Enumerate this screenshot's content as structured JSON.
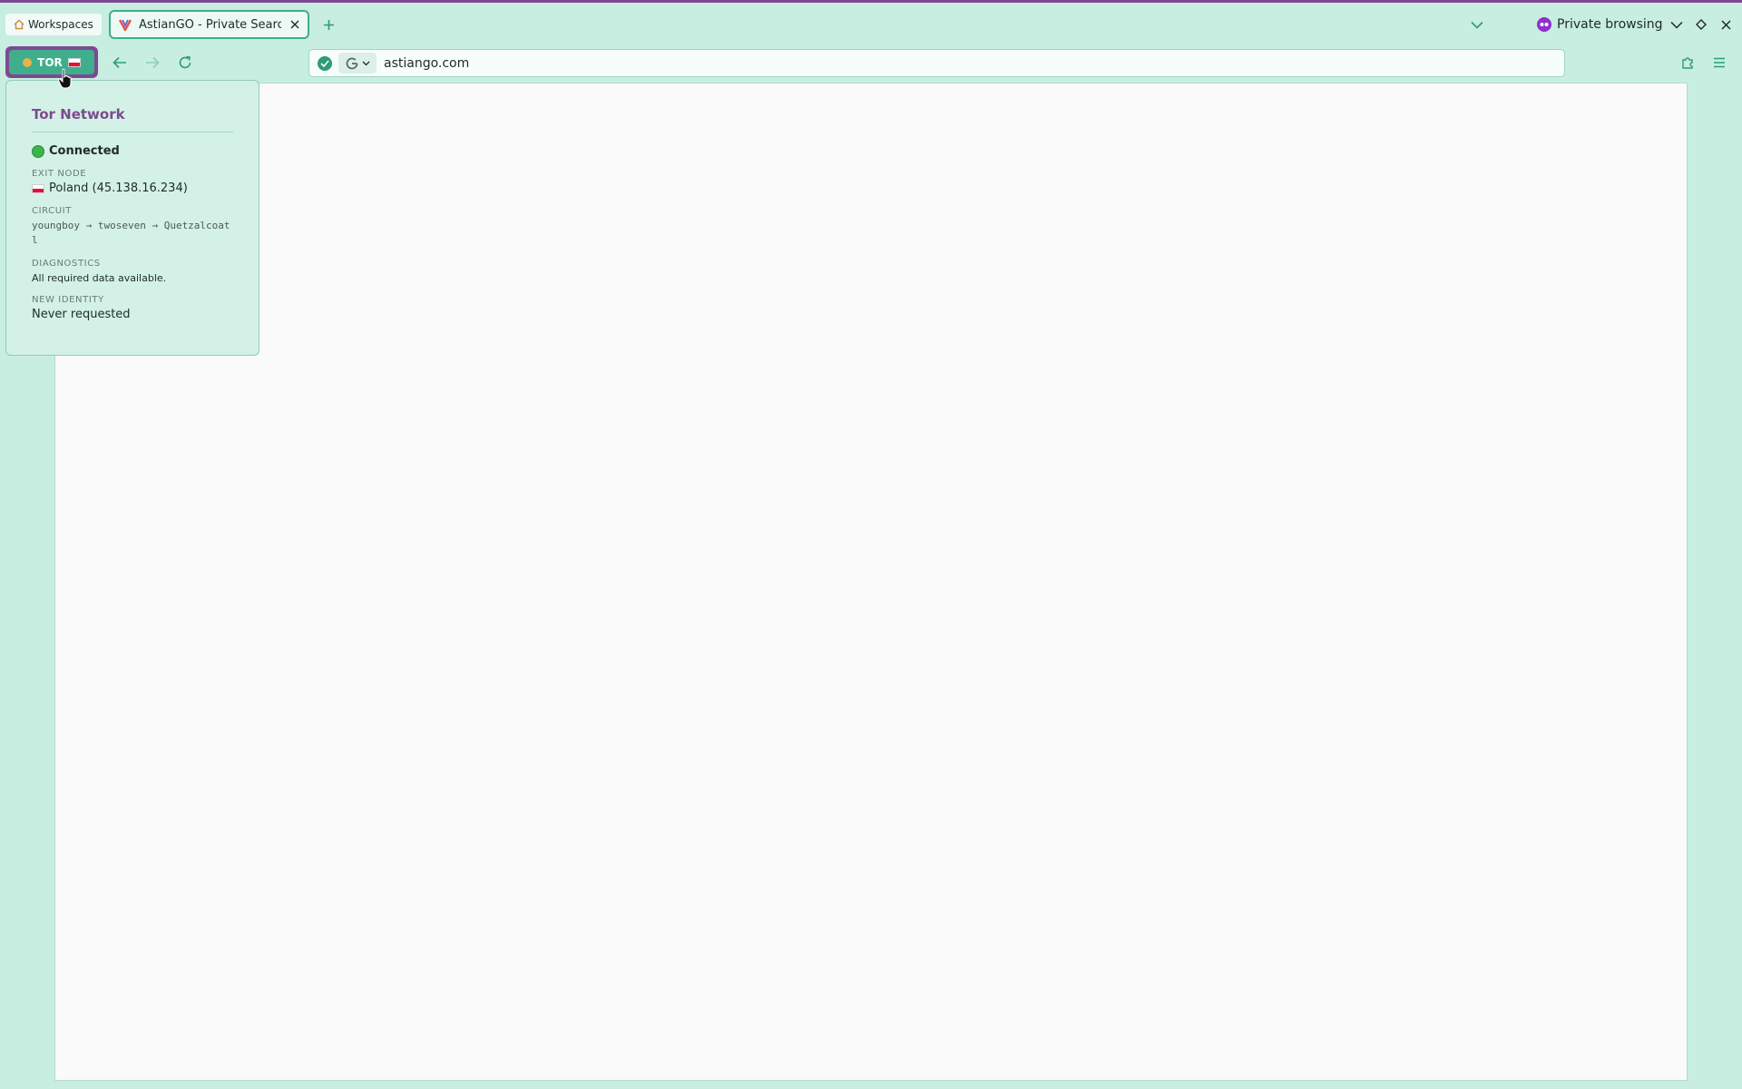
{
  "tabstrip": {
    "workspaces_label": "Workspaces",
    "tab": {
      "title": "AstianGO - Private Search E"
    },
    "private_label": "Private browsing"
  },
  "navbar": {
    "tor_badge": "TOR",
    "url": "astiango.com"
  },
  "tor_popup": {
    "title": "Tor Network",
    "status": "Connected",
    "exit_node_label": "EXIT NODE",
    "exit_node_value": "Poland (45.138.16.234)",
    "circuit_label": "CIRCUIT",
    "circuit_value": "youngboy → twoseven → Quetzalcoatl",
    "diagnostics_label": "DIAGNOSTICS",
    "diagnostics_value": "All required data available.",
    "new_identity_label": "NEW IDENTITY",
    "new_identity_value": "Never requested"
  },
  "colors": {
    "chrome_bg": "#c8ede1",
    "accent": "#3fae8c",
    "tor_purple": "#7d4a8f",
    "private_purple": "#8f2fcf"
  },
  "icons": {
    "home": "home-icon",
    "favicon": "astiango-favicon-icon",
    "close": "close-icon",
    "new_tab": "plus-icon",
    "tab_list": "chevron-down-icon",
    "private": "mask-icon",
    "back": "arrow-left-icon",
    "forward": "arrow-right-icon",
    "reload": "reload-icon",
    "shield": "shield-check-icon",
    "search_engine": "google-icon",
    "extensions": "puzzle-icon",
    "menu": "hamburger-menu-icon"
  }
}
